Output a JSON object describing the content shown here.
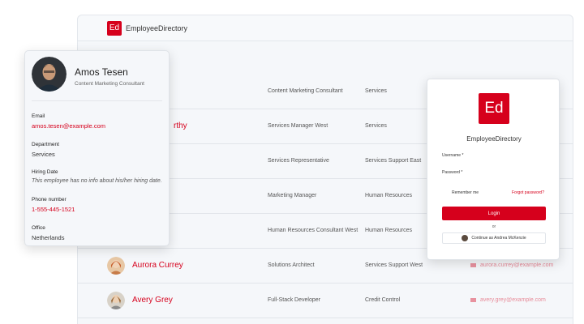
{
  "app": {
    "logo_text": "Ed",
    "title": "EmployeeDirectory"
  },
  "rows": [
    {
      "name": "",
      "title": "Content Marketing Consultant",
      "department": "Services",
      "email": ""
    },
    {
      "name": "rthy",
      "title": "Services Manager West",
      "department": "Services",
      "email": ""
    },
    {
      "name": "",
      "title": "Services Representative",
      "department": "Services Support East",
      "email": ""
    },
    {
      "name": "",
      "title": "Marketing Manager",
      "department": "Human Resources",
      "email": ""
    },
    {
      "name": "",
      "title": "Human Resources Consultant West",
      "department": "Human Resources",
      "email": ""
    },
    {
      "name": "Aurora Currey",
      "title": "Solutions Architect",
      "department": "Services Support West",
      "email": "aurora.currey@example.com"
    },
    {
      "name": "Avery Grey",
      "title": "Full-Stack Developer",
      "department": "Credit Control",
      "email": "avery.grey@example.com"
    }
  ],
  "profile": {
    "name": "Amos Tesen",
    "role": "Content Marketing Consultant",
    "email_label": "Email",
    "email": "amos.tesen@example.com",
    "department_label": "Department",
    "department": "Services",
    "hiring_label": "Hiring Date",
    "hiring": "This employee has no info about his/her hiring date.",
    "phone_label": "Phone number",
    "phone": "1-555-445-1521",
    "office_label": "Office",
    "office": "Netherlands"
  },
  "login": {
    "logo_text": "Ed",
    "app_name": "EmployeeDirectory",
    "username_label": "Username *",
    "password_label": "Password *",
    "remember": "Remember me",
    "forgot": "Forgot password?",
    "login_button": "Login",
    "or": "or",
    "continue": "Continue as Andrea McKenzie"
  },
  "colors": {
    "accent": "#d6001c"
  }
}
